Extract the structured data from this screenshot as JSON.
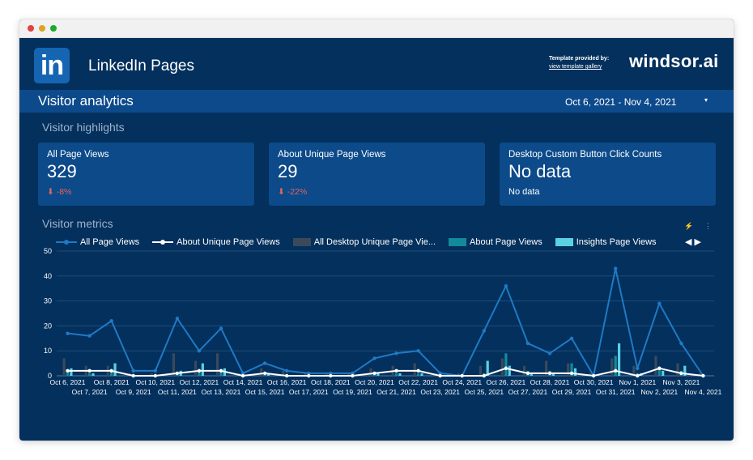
{
  "window": {
    "dots": [
      "#e0443e",
      "#dea123",
      "#1aab29"
    ]
  },
  "header": {
    "logo_text": "in",
    "title": "LinkedIn Pages",
    "provided_label": "Template provided by:",
    "gallery_link": "view template gallery",
    "brand": "windsor.ai"
  },
  "subbar": {
    "title": "Visitor analytics",
    "date_range": "Oct 6, 2021 - Nov 4, 2021",
    "caret": "▾"
  },
  "highlights": {
    "title": "Visitor highlights",
    "cards": [
      {
        "label": "All Page Views",
        "value": "329",
        "delta": "⬇ -8%"
      },
      {
        "label": "About Unique Page Views",
        "value": "29",
        "delta": "⬇ -22%"
      },
      {
        "label": "Desktop Custom Button Click Counts",
        "value": "No data",
        "sub": "No data"
      }
    ]
  },
  "metrics": {
    "title": "Visitor metrics",
    "tool_icons": [
      "⚡",
      "⋮"
    ],
    "legend_nav": [
      "◀",
      "▶"
    ]
  },
  "chart_data": {
    "type": "line",
    "ylim": [
      0,
      50
    ],
    "yticks": [
      "0",
      "10",
      "20",
      "30",
      "40",
      "50"
    ],
    "grid": true,
    "legend_position": "top",
    "x": [
      "Oct 6, 2021",
      "Oct 7, 2021",
      "Oct 8, 2021",
      "Oct 9, 2021",
      "Oct 10, 2021",
      "Oct 11, 2021",
      "Oct 12, 2021",
      "Oct 13, 2021",
      "Oct 14, 2021",
      "Oct 15, 2021",
      "Oct 16, 2021",
      "Oct 17, 2021",
      "Oct 18, 2021",
      "Oct 19, 2021",
      "Oct 20, 2021",
      "Oct 21, 2021",
      "Oct 22, 2021",
      "Oct 23, 2021",
      "Oct 24, 2021",
      "Oct 25, 2021",
      "Oct 26, 2021",
      "Oct 27, 2021",
      "Oct 28, 2021",
      "Oct 29, 2021",
      "Oct 30, 2021",
      "Oct 31, 2021",
      "Nov 1, 2021",
      "Nov 2, 2021",
      "Nov 3, 2021",
      "Nov 4, 2021"
    ],
    "series": [
      {
        "name": "All Page Views",
        "kind": "line",
        "color": "#1f7ac4",
        "values": [
          17,
          16,
          22,
          2,
          2,
          23,
          10,
          19,
          1,
          5,
          2,
          1,
          1,
          1,
          7,
          9,
          10,
          1,
          0,
          18,
          36,
          13,
          9,
          15,
          0,
          43,
          3,
          29,
          13,
          0
        ]
      },
      {
        "name": "About Unique Page Views",
        "kind": "line",
        "color": "#ffffff",
        "values": [
          2,
          2,
          2,
          0,
          0,
          1,
          2,
          2,
          0,
          1,
          0,
          0,
          0,
          0,
          1,
          2,
          2,
          0,
          0,
          0,
          3,
          1,
          1,
          1,
          0,
          2,
          0,
          3,
          1,
          0
        ]
      },
      {
        "name": "All Desktop Unique Page Vie...",
        "kind": "bar",
        "color": "#3a4a5a",
        "values": [
          7,
          4,
          4,
          1,
          1,
          9,
          6,
          9,
          1,
          3,
          2,
          1,
          1,
          1,
          3,
          4,
          5,
          1,
          1,
          4,
          7,
          4,
          6,
          5,
          1,
          7,
          4,
          8,
          5,
          1
        ]
      },
      {
        "name": "About Page Views",
        "kind": "bar",
        "color": "#138a9a",
        "values": [
          2,
          1,
          2,
          0,
          0,
          1,
          2,
          2,
          0,
          1,
          0,
          0,
          0,
          0,
          1,
          1,
          1,
          0,
          0,
          1,
          9,
          2,
          2,
          5,
          0,
          8,
          1,
          3,
          2,
          0
        ]
      },
      {
        "name": "Insights Page Views",
        "kind": "bar",
        "color": "#5ad2e2",
        "values": [
          3,
          1,
          5,
          0,
          0,
          2,
          5,
          3,
          0,
          1,
          0,
          0,
          0,
          0,
          1,
          1,
          1,
          0,
          0,
          6,
          4,
          1,
          1,
          3,
          0,
          13,
          1,
          2,
          4,
          0
        ]
      }
    ]
  }
}
